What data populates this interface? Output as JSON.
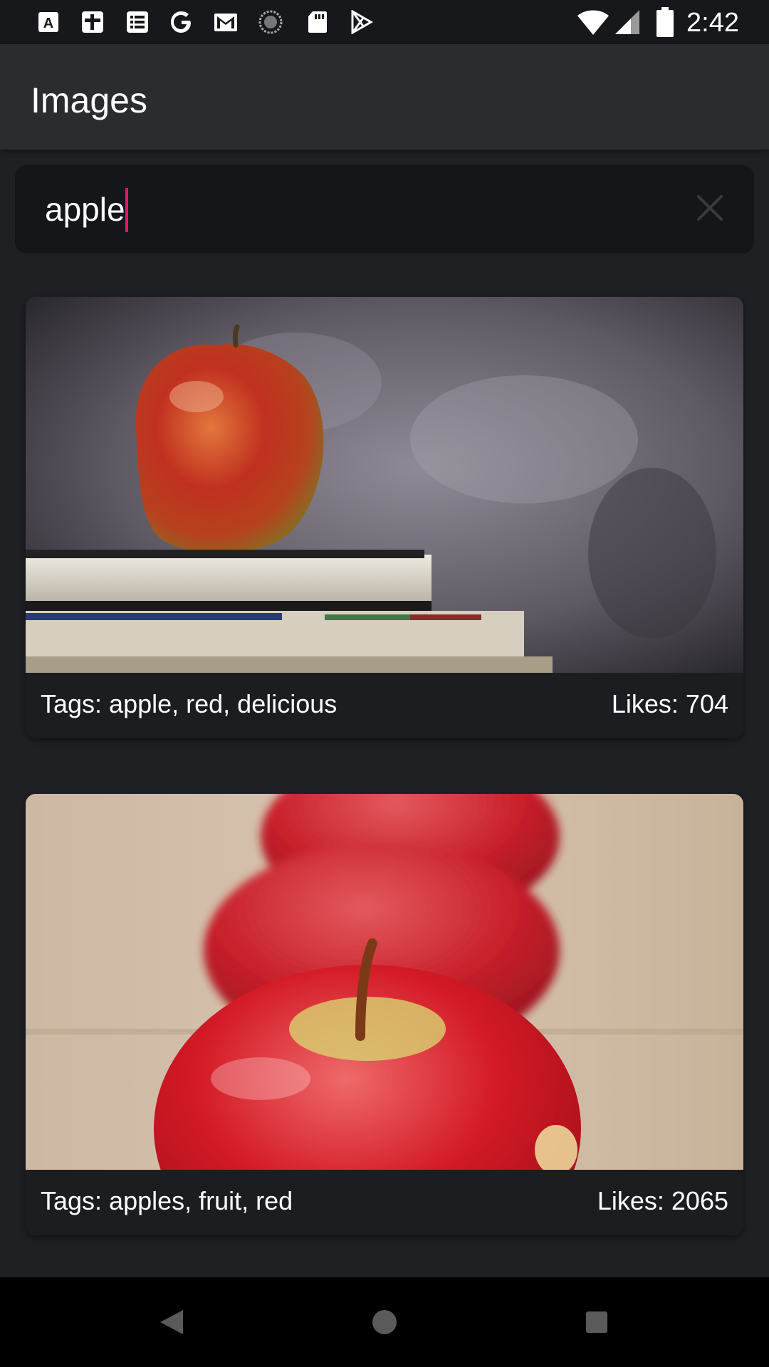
{
  "status_bar": {
    "time": "2:42",
    "notification_icons": [
      "translate-icon",
      "calendar-grid-icon",
      "news-list-icon",
      "google-icon",
      "gmail-icon",
      "sync-progress-icon",
      "sd-card-icon",
      "play-store-icon"
    ],
    "system_icons": [
      "wifi-icon",
      "signal-icon",
      "battery-icon"
    ]
  },
  "app_bar": {
    "title": "Images"
  },
  "search": {
    "value": "apple",
    "clear_icon": "close-icon"
  },
  "results": [
    {
      "tags": "Tags: apple, red, delicious",
      "likes": "Likes: 704",
      "image": "apple-on-books"
    },
    {
      "tags": "Tags: apples, fruit, red",
      "likes": "Likes: 2065",
      "image": "row-of-red-apples"
    }
  ],
  "nav_bar": {
    "buttons": [
      "back-icon",
      "home-icon",
      "recents-icon"
    ]
  },
  "colors": {
    "background": "#1f2024",
    "app_bar": "#2b2c30",
    "search_bg": "#151619",
    "caret": "#e0186a"
  }
}
